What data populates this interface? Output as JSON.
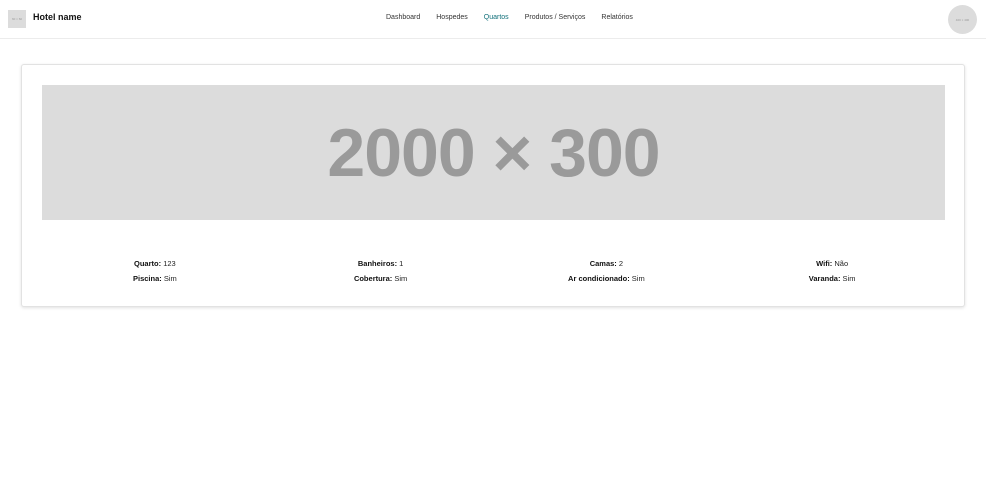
{
  "header": {
    "logo_text": "60 × 60",
    "brand": "Hotel name",
    "nav": [
      "Dashboard",
      "Hospedes",
      "Quartos",
      "Produtos / Serviços",
      "Relatórios"
    ],
    "active_nav": "Quartos",
    "avatar_text": "400 × 400"
  },
  "room": {
    "banner_text": "2000 × 300",
    "details": [
      {
        "label": "Quarto:",
        "value": "123"
      },
      {
        "label": "Banheiros:",
        "value": "1"
      },
      {
        "label": "Camas:",
        "value": "2"
      },
      {
        "label": "Wifi:",
        "value": "Não"
      },
      {
        "label": "Piscina:",
        "value": "Sim"
      },
      {
        "label": "Cobertura:",
        "value": "Sim"
      },
      {
        "label": "Ar condicionado:",
        "value": "Sim"
      },
      {
        "label": "Varanda:",
        "value": "Sim"
      }
    ]
  },
  "colors": {
    "accent": "#11707a",
    "placeholder": "#dcdcdc",
    "placeholder_text": "#9a9a9a"
  }
}
